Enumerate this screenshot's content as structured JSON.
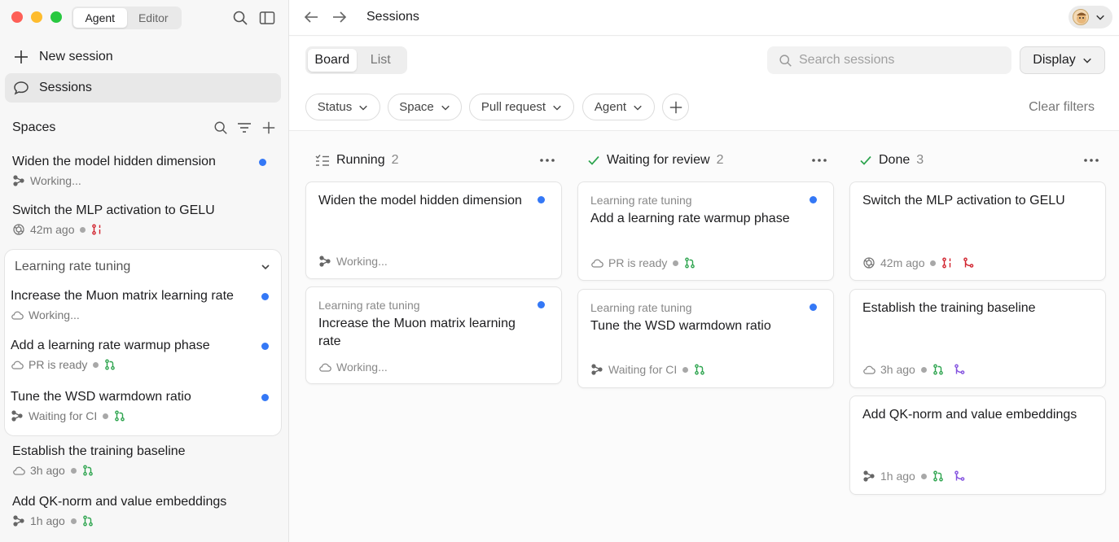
{
  "sidebar": {
    "mode_tabs": [
      "Agent",
      "Editor"
    ],
    "new_session": "New session",
    "sessions": "Sessions",
    "spaces_title": "Spaces",
    "items": [
      {
        "title": "Widen the model hidden dimension",
        "status": "Working..."
      },
      {
        "title": "Switch the MLP activation to GELU",
        "status": "42m ago"
      }
    ],
    "group": {
      "name": "Learning rate tuning",
      "items": [
        {
          "title": "Increase the Muon matrix learning rate",
          "status": "Working..."
        },
        {
          "title": "Add a learning rate warmup phase",
          "status": "PR is ready"
        },
        {
          "title": "Tune the WSD warmdown ratio",
          "status": "Waiting for CI"
        }
      ]
    },
    "items_after": [
      {
        "title": "Establish the training baseline",
        "status": "3h ago"
      },
      {
        "title": "Add QK-norm and value embeddings",
        "status": "1h ago"
      }
    ]
  },
  "topbar": {
    "title": "Sessions"
  },
  "toolbar": {
    "view_tabs": [
      "Board",
      "List"
    ],
    "search_placeholder": "Search sessions",
    "display_label": "Display",
    "filters": [
      "Status",
      "Space",
      "Pull request",
      "Agent"
    ],
    "clear_filters": "Clear filters"
  },
  "columns": [
    {
      "name": "Running",
      "count": "2",
      "cards": [
        {
          "space": "",
          "title": "Widen the model hidden dimension",
          "status": "Working..."
        },
        {
          "space": "Learning rate tuning",
          "title": "Increase the Muon matrix learning rate",
          "status": "Working..."
        }
      ]
    },
    {
      "name": "Waiting for review",
      "count": "2",
      "cards": [
        {
          "space": "Learning rate tuning",
          "title": "Add a learning rate warmup phase",
          "status": "PR is ready"
        },
        {
          "space": "Learning rate tuning",
          "title": "Tune the WSD warmdown ratio",
          "status": "Waiting for CI"
        }
      ]
    },
    {
      "name": "Done",
      "count": "3",
      "cards": [
        {
          "space": "",
          "title": "Switch the MLP activation to GELU",
          "status": "42m ago"
        },
        {
          "space": "",
          "title": "Establish the training baseline",
          "status": "3h ago"
        },
        {
          "space": "",
          "title": "Add QK-norm and value embeddings",
          "status": "1h ago"
        }
      ]
    }
  ],
  "colors": {
    "accent_blue": "#3478f6",
    "pr_open_green": "#2da44e",
    "pr_closed_red": "#d1242f",
    "merged_purple": "#8250df",
    "done_check_green": "#2da44e"
  },
  "icons": [
    "search-icon",
    "sidebar-toggle-icon",
    "plus-icon",
    "chat-bubble-icon",
    "filter-icon",
    "chevron-down-icon",
    "back-arrow-icon",
    "forward-arrow-icon",
    "checklist-icon",
    "checkmark-icon",
    "more-icon",
    "agent-icon",
    "cloud-icon",
    "openai-icon",
    "pull-request-icon",
    "merge-icon"
  ]
}
